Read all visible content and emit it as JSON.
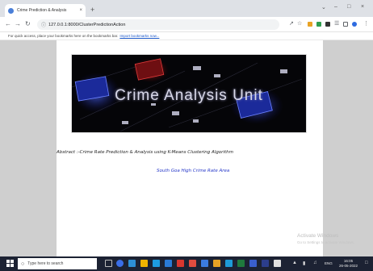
{
  "browser": {
    "tab_title": "Crime Prediction & Analysis",
    "tab_close": "×",
    "new_tab": "+",
    "window_controls": {
      "chevron": "⌄",
      "minimize": "–",
      "maximize": "□",
      "close": "×"
    },
    "url": "127.0.0.1:8000/ClusterPredictionAction",
    "bookmark_bar_text": "For quick access, place your bookmarks here on the bookmarks bar.",
    "bookmark_link": "Import bookmarks now..."
  },
  "page": {
    "banner_title": "Crime Analysis Unit",
    "abstract": "Abstract :-Crime Rate Prediction & Analysis using K-Means Clustering Algorithm",
    "area_link": "South Goa High Crime Rate Area"
  },
  "watermark": {
    "title": "Activate Windows",
    "subtitle": "Go to Settings to activate Windows."
  },
  "taskbar": {
    "search_placeholder": "Type here to search",
    "tray_language": "ENG",
    "time": "16:05",
    "date": "26-05-2022"
  },
  "colors": {
    "tabstrip": "#dee1e6",
    "page_background": "#cfcfcf",
    "banner_background": "#050508",
    "link": "#2436c8",
    "taskbar": "#1c2233"
  }
}
